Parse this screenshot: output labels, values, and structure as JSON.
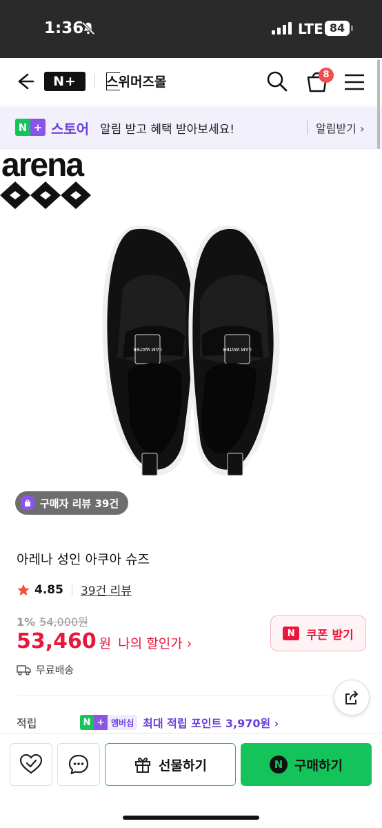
{
  "status_bar": {
    "time": "1:36",
    "network": "LTE",
    "battery": "84"
  },
  "header": {
    "logo": "N+",
    "store_name": "스위머즈몰",
    "cart_count": "8"
  },
  "banner": {
    "store_label": "스토어",
    "message": "알림 받고 혜택 받아보세요!",
    "action": "알림받기 ›"
  },
  "product": {
    "brand": "arena",
    "review_chip": "구매자 리뷰 39건",
    "title": "아레나 성인 아쿠아 슈즈",
    "rating": "4.85",
    "review_count": "39건 리뷰",
    "discount_rate": "1%",
    "original_price": "54,000원",
    "price": "53,460",
    "price_unit": "원",
    "my_discount": "나의 할인가 ›",
    "shipping": "무료배송",
    "shoe_label": "I AM WATER"
  },
  "coupon": {
    "label": "쿠폰 받기",
    "icon_text": "N"
  },
  "points": {
    "label": "적립",
    "member_label": "멤버십",
    "text": "최대 적립 포인트 3,970원 ›"
  },
  "actions": {
    "gift": "선물하기",
    "buy": "구매하기"
  },
  "colors": {
    "naver_green": "#14c45a",
    "plus_purple": "#8b54e8",
    "price_red": "#e8183c"
  }
}
